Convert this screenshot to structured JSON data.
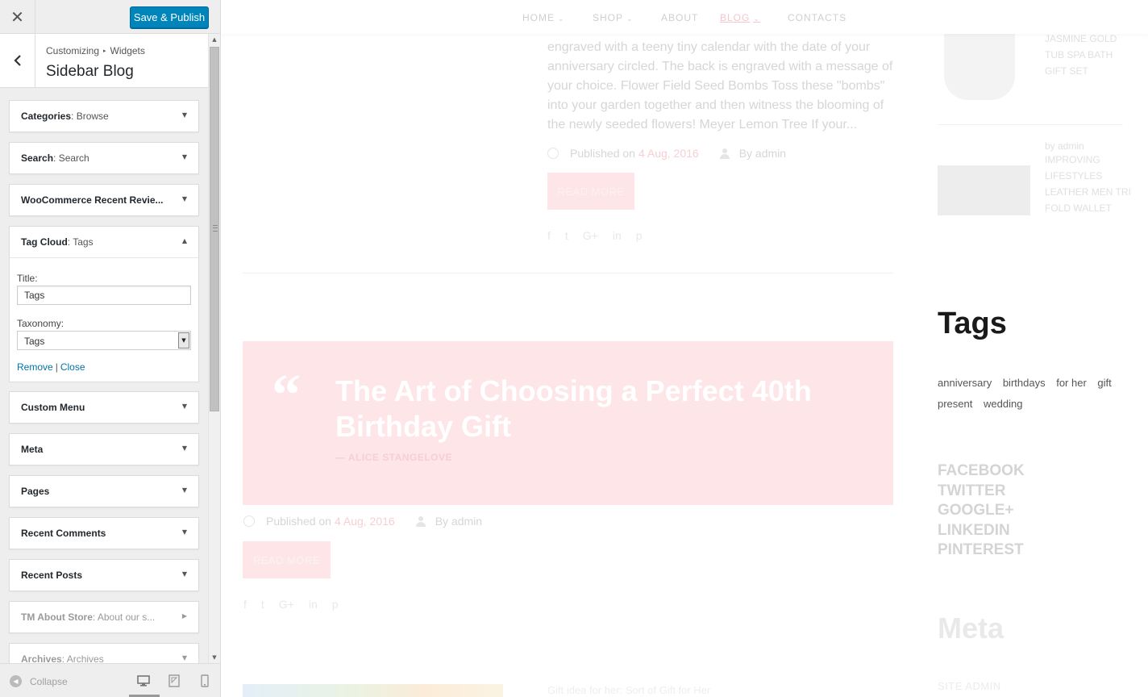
{
  "customizer": {
    "close_glyph": "✕",
    "save_label": "Save & Publish",
    "breadcrumb": [
      "Customizing",
      "Widgets"
    ],
    "breadcrumb_sep": "▸",
    "section_title": "Sidebar Blog",
    "widgets": [
      {
        "name": "Categories",
        "sub": ": Browse",
        "state": "collapsed"
      },
      {
        "name": "Search",
        "sub": ": Search",
        "state": "collapsed"
      },
      {
        "name": "WooCommerce Recent Revie...",
        "sub": "",
        "state": "collapsed"
      },
      {
        "name": "Tag Cloud",
        "sub": ": Tags",
        "state": "expanded"
      },
      {
        "name": "Custom Menu",
        "sub": "",
        "state": "collapsed"
      },
      {
        "name": "Meta",
        "sub": "",
        "state": "collapsed"
      },
      {
        "name": "Pages",
        "sub": "",
        "state": "collapsed"
      },
      {
        "name": "Recent Comments",
        "sub": "",
        "state": "collapsed"
      },
      {
        "name": "Recent Posts",
        "sub": "",
        "state": "collapsed"
      },
      {
        "name": "TM About Store",
        "sub": ": About our s...",
        "state": "disabled"
      },
      {
        "name": "Archives",
        "sub": ": Archives",
        "state": "disabled"
      }
    ],
    "tag_cloud_form": {
      "title_label": "Title:",
      "title_value": "Tags",
      "taxonomy_label": "Taxonomy:",
      "taxonomy_value": "Tags",
      "remove_label": "Remove",
      "separator": "|",
      "close_label": "Close"
    },
    "footer": {
      "collapse_label": "Collapse",
      "devices": [
        "desktop",
        "tablet",
        "mobile"
      ],
      "active_device": "desktop"
    }
  },
  "preview": {
    "nav": [
      {
        "label": "HOME",
        "dropdown": true
      },
      {
        "label": "SHOP",
        "dropdown": true
      },
      {
        "label": "ABOUT",
        "dropdown": false
      },
      {
        "label": "BLOG",
        "dropdown": true,
        "active": true
      },
      {
        "label": "CONTACTS",
        "dropdown": false
      }
    ],
    "post1": {
      "excerpt": "engraved with a teeny tiny calendar with the date of your anniversary circled. The back is engraved with a message of your choice.  Flower Field Seed Bombs Toss these \"bombs\" into your garden together and then witness the blooming of the newly seeded flowers! Meyer Lemon Tree If your...",
      "published_prefix": "Published on",
      "date": "4 Aug, 2016",
      "author": "By admin",
      "read_more": "READ MORE"
    },
    "quote_post": {
      "quote_mark": "“",
      "title": "The Art of Choosing a Perfect 40th Birthday Gift",
      "author": "— ALICE STANGELOVE",
      "published_prefix": "Published on",
      "date": "4 Aug, 2016",
      "by": "By admin",
      "read_more": "READ MORE"
    },
    "social_icons": [
      "f",
      "t",
      "G+",
      "in",
      "p"
    ],
    "products": [
      {
        "byline": "",
        "name": "JASMINE GOLD TUB SPA BATH GIFT SET"
      },
      {
        "byline": "by admin",
        "name": "IMPROVING LIFESTYLES LEATHER MEN TRI FOLD WALLET"
      }
    ],
    "tags_heading": "Tags",
    "tags": [
      "anniversary",
      "birthdays",
      "for her",
      "gift",
      "present",
      "wedding"
    ],
    "social_links": [
      "FACEBOOK",
      "TWITTER",
      "GOOGLE+",
      "LINKEDIN",
      "PINTEREST"
    ],
    "meta_heading": "Meta",
    "site_admin": "SITE ADMIN",
    "bottom_text": "Gift idea for her: Sort of Gift for Her"
  },
  "colors": {
    "primary_button": "#0085ba",
    "link": "#0073aa",
    "accent_pink": "#fde5e8"
  }
}
